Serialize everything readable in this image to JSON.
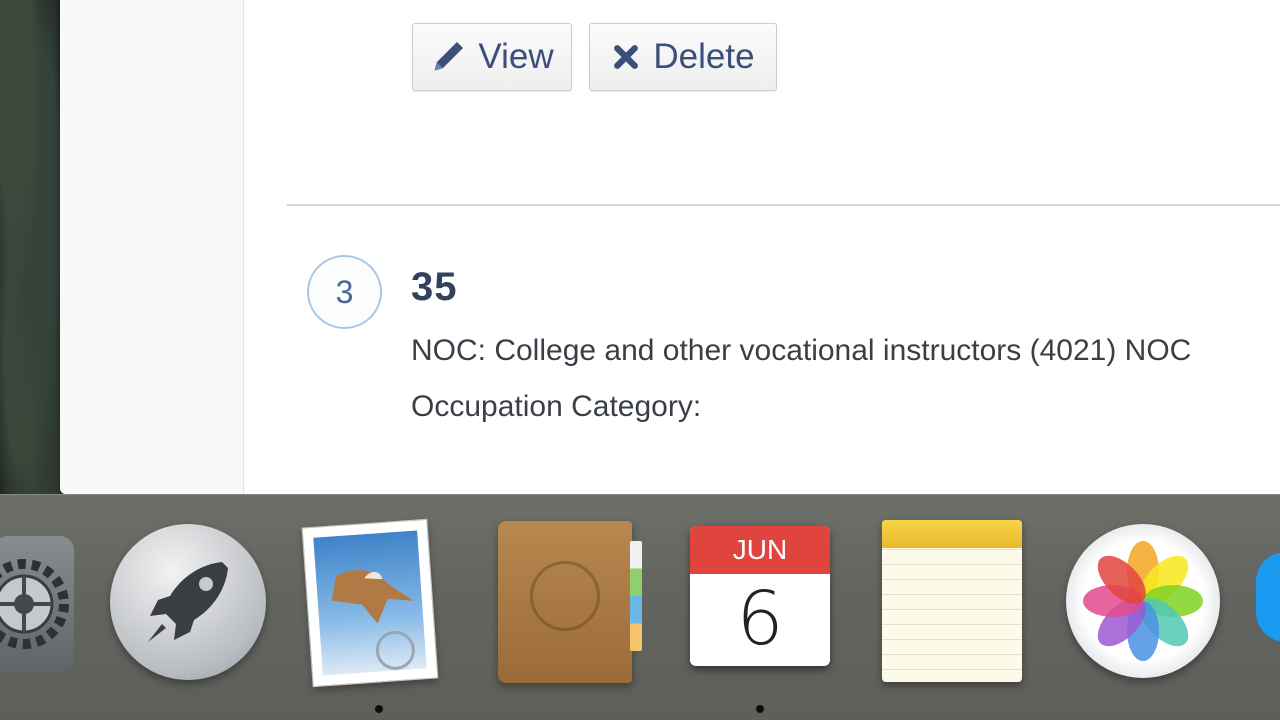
{
  "actions": {
    "view_label": "View",
    "delete_label": "Delete"
  },
  "item": {
    "index": "3",
    "title": "35",
    "noc_line": "NOC: College and other vocational instructors (4021) NOC",
    "occupation_category": "Occupation Category:"
  },
  "dock": {
    "calendar_month": "JUN",
    "calendar_day": "6",
    "apps": [
      "System Preferences",
      "Launchpad",
      "Mail",
      "Contacts",
      "Calendar",
      "Notes",
      "Photos"
    ],
    "running": [
      "Mail",
      "Calendar"
    ]
  },
  "colors": {
    "button_text": "#3c4e7a",
    "badge_border": "#a9c8e6",
    "calendar_red": "#e0443f"
  },
  "icons": [
    "pencil-icon",
    "close-icon"
  ]
}
